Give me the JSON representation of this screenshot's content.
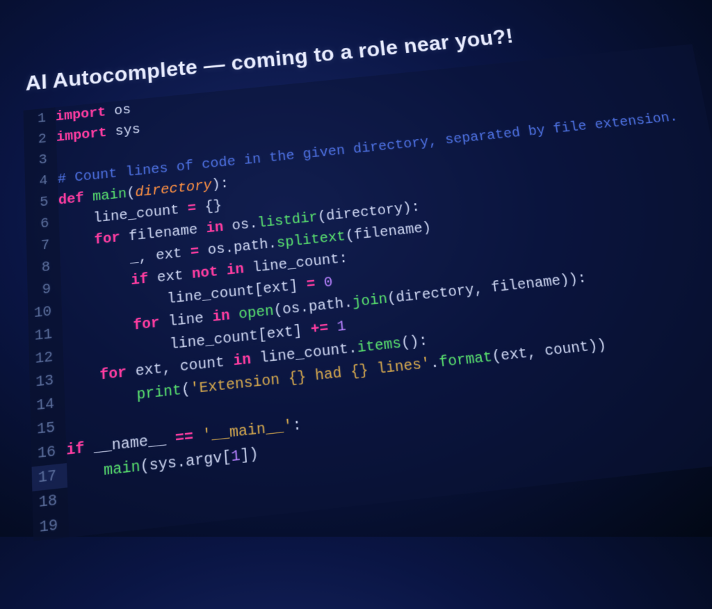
{
  "title": "AI Autocomplete — coming to a role near you?!",
  "lines": [
    [
      {
        "t": "import ",
        "c": "kw"
      },
      {
        "t": "os",
        "c": "mod"
      }
    ],
    [
      {
        "t": "import ",
        "c": "kw"
      },
      {
        "t": "sys",
        "c": "mod"
      }
    ],
    [],
    [
      {
        "t": "# Count lines of code in the given directory, separated by file extension.",
        "c": "com"
      }
    ],
    [
      {
        "t": "def ",
        "c": "kw"
      },
      {
        "t": "main",
        "c": "fn"
      },
      {
        "t": "(",
        "c": "pun"
      },
      {
        "t": "directory",
        "c": "par"
      },
      {
        "t": "):",
        "c": "pun"
      }
    ],
    [
      {
        "t": "    line_count ",
        "c": "var"
      },
      {
        "t": "= ",
        "c": "kw"
      },
      {
        "t": "{}",
        "c": "pun"
      }
    ],
    [
      {
        "t": "    ",
        "c": "var"
      },
      {
        "t": "for ",
        "c": "kw"
      },
      {
        "t": "filename ",
        "c": "var"
      },
      {
        "t": "in ",
        "c": "kw"
      },
      {
        "t": "os",
        "c": "mod"
      },
      {
        "t": ".",
        "c": "pun"
      },
      {
        "t": "listdir",
        "c": "meth"
      },
      {
        "t": "(directory):",
        "c": "pun"
      }
    ],
    [
      {
        "t": "        _, ext ",
        "c": "var"
      },
      {
        "t": "= ",
        "c": "kw"
      },
      {
        "t": "os",
        "c": "mod"
      },
      {
        "t": ".",
        "c": "pun"
      },
      {
        "t": "path",
        "c": "mod"
      },
      {
        "t": ".",
        "c": "pun"
      },
      {
        "t": "splitext",
        "c": "meth"
      },
      {
        "t": "(filename)",
        "c": "pun"
      }
    ],
    [
      {
        "t": "        ",
        "c": "var"
      },
      {
        "t": "if ",
        "c": "kw"
      },
      {
        "t": "ext ",
        "c": "var"
      },
      {
        "t": "not in ",
        "c": "kw"
      },
      {
        "t": "line_count:",
        "c": "var"
      }
    ],
    [
      {
        "t": "            line_count[ext] ",
        "c": "var"
      },
      {
        "t": "= ",
        "c": "kw"
      },
      {
        "t": "0",
        "c": "num"
      }
    ],
    [
      {
        "t": "        ",
        "c": "var"
      },
      {
        "t": "for ",
        "c": "kw"
      },
      {
        "t": "line ",
        "c": "var"
      },
      {
        "t": "in ",
        "c": "kw"
      },
      {
        "t": "open",
        "c": "fn"
      },
      {
        "t": "(os",
        "c": "pun"
      },
      {
        "t": ".",
        "c": "pun"
      },
      {
        "t": "path",
        "c": "mod"
      },
      {
        "t": ".",
        "c": "pun"
      },
      {
        "t": "join",
        "c": "meth"
      },
      {
        "t": "(directory, filename)):",
        "c": "pun"
      }
    ],
    [
      {
        "t": "            line_count[ext] ",
        "c": "var"
      },
      {
        "t": "+= ",
        "c": "kw"
      },
      {
        "t": "1",
        "c": "num"
      }
    ],
    [
      {
        "t": "    ",
        "c": "var"
      },
      {
        "t": "for ",
        "c": "kw"
      },
      {
        "t": "ext, count ",
        "c": "var"
      },
      {
        "t": "in ",
        "c": "kw"
      },
      {
        "t": "line_count",
        "c": "var"
      },
      {
        "t": ".",
        "c": "pun"
      },
      {
        "t": "items",
        "c": "meth"
      },
      {
        "t": "():",
        "c": "pun"
      }
    ],
    [
      {
        "t": "        ",
        "c": "var"
      },
      {
        "t": "print",
        "c": "fn"
      },
      {
        "t": "(",
        "c": "pun"
      },
      {
        "t": "'Extension {} had {} lines'",
        "c": "str"
      },
      {
        "t": ".",
        "c": "pun"
      },
      {
        "t": "format",
        "c": "meth"
      },
      {
        "t": "(ext, count))",
        "c": "pun"
      }
    ],
    [],
    [
      {
        "t": "if ",
        "c": "kw"
      },
      {
        "t": "__name__ ",
        "c": "var"
      },
      {
        "t": "== ",
        "c": "kw"
      },
      {
        "t": "'__main__'",
        "c": "str"
      },
      {
        "t": ":",
        "c": "pun"
      }
    ],
    [
      {
        "t": "    ",
        "c": "var"
      },
      {
        "t": "main",
        "c": "fn"
      },
      {
        "t": "(sys",
        "c": "pun"
      },
      {
        "t": ".",
        "c": "pun"
      },
      {
        "t": "argv[",
        "c": "var"
      },
      {
        "t": "1",
        "c": "num"
      },
      {
        "t": "])",
        "c": "pun"
      }
    ],
    [],
    []
  ],
  "current_line_index": 16
}
